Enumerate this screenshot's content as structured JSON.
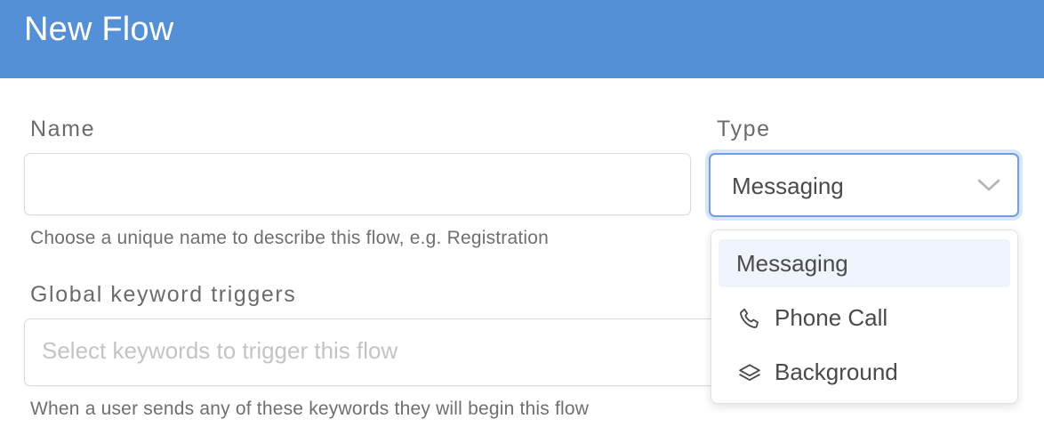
{
  "header": {
    "title": "New Flow"
  },
  "name_field": {
    "label": "Name",
    "value": "",
    "help": "Choose a unique name to describe this flow, e.g. Registration"
  },
  "keywords_field": {
    "label": "Global keyword triggers",
    "placeholder": "Select keywords to trigger this flow",
    "help": "When a user sends any of these keywords they will begin this flow"
  },
  "type_field": {
    "label": "Type",
    "selected": "Messaging",
    "options": [
      {
        "label": "Messaging",
        "icon": "none",
        "selected": true
      },
      {
        "label": "Phone Call",
        "icon": "phone-icon",
        "selected": false
      },
      {
        "label": "Background",
        "icon": "layers-icon",
        "selected": false
      }
    ]
  },
  "colors": {
    "header_bg": "#5390d8",
    "focus_border": "#6f9fe0",
    "selected_option_bg": "#eff4fc"
  }
}
